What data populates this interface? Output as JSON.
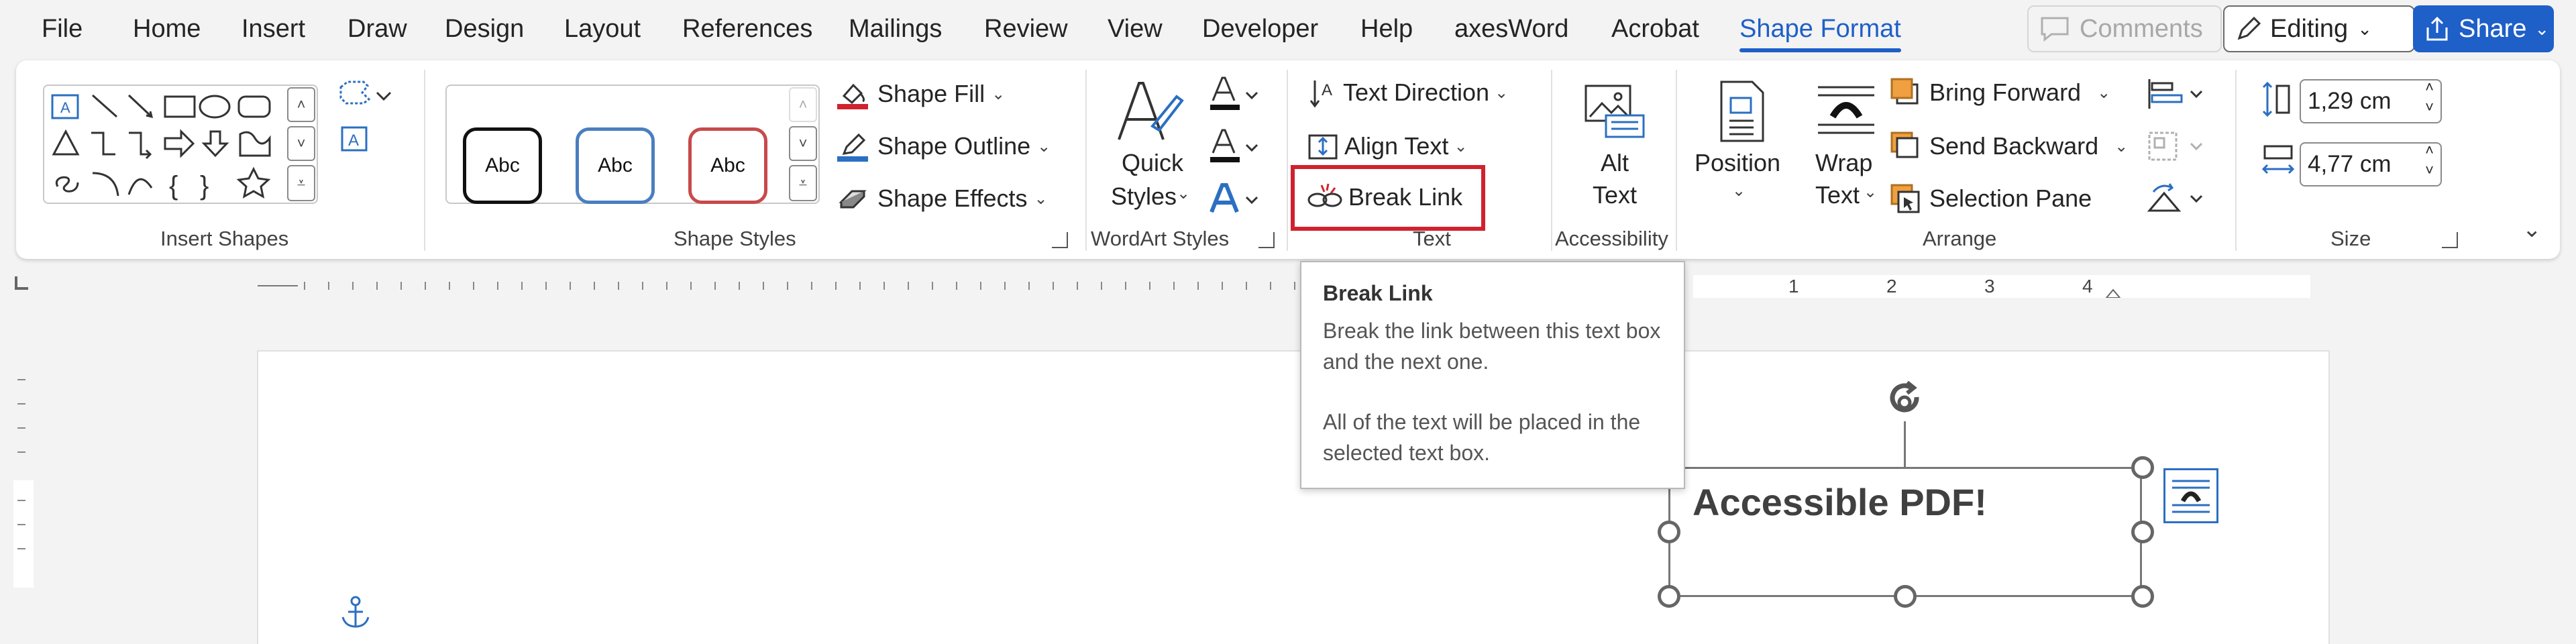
{
  "tabs": [
    "File",
    "Home",
    "Insert",
    "Draw",
    "Design",
    "Layout",
    "References",
    "Mailings",
    "Review",
    "View",
    "Developer",
    "Help",
    "axesWord",
    "Acrobat",
    "Shape Format"
  ],
  "active_tab": "Shape Format",
  "top_actions": {
    "comments": "Comments",
    "editing": "Editing",
    "share": "Share"
  },
  "ribbon": {
    "insert_shapes": {
      "label": "Insert Shapes"
    },
    "shape_styles": {
      "label": "Shape Styles",
      "style_sample": "Abc",
      "fill": "Shape Fill",
      "outline": "Shape Outline",
      "effects": "Shape Effects"
    },
    "wordart": {
      "label": "WordArt Styles",
      "quick_line1": "Quick",
      "quick_line2": "Styles"
    },
    "text": {
      "label": "Text",
      "direction": "Text Direction",
      "align": "Align Text",
      "break_link": "Break Link"
    },
    "accessibility": {
      "label": "Accessibility",
      "alt_line1": "Alt",
      "alt_line2": "Text"
    },
    "arrange": {
      "label": "Arrange",
      "position": "Position",
      "wrap_line1": "Wrap",
      "wrap_line2": "Text",
      "bring_forward": "Bring Forward",
      "send_backward": "Send Backward",
      "selection_pane": "Selection Pane"
    },
    "size": {
      "label": "Size",
      "height": "1,29 cm",
      "width": "4,77 cm"
    }
  },
  "ruler": {
    "numbers": [
      "1",
      "2",
      "3",
      "4"
    ]
  },
  "tooltip": {
    "title": "Break Link",
    "line1": "Break the link between this text box",
    "line2": "and the next one.",
    "line3": "All of the text will be placed in the",
    "line4": "selected text box."
  },
  "document": {
    "textbox_text": "Accessible PDF!"
  },
  "colors": {
    "accent": "#1e5fc8",
    "highlight_box": "#d0222e",
    "icon_blue": "#2b6fc2",
    "shape_orange": "#f0a040"
  }
}
